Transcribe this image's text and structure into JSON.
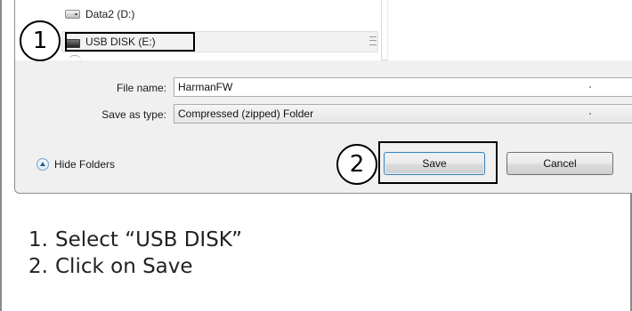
{
  "folder_tree": {
    "items": [
      {
        "label": "Data2 (D:)",
        "icon": "hard-drive-icon"
      },
      {
        "label": "USB DISK (E:)",
        "icon": "usb-drive-icon",
        "selected": true
      }
    ]
  },
  "form": {
    "file_name_label": "File name:",
    "file_name_value": "HarmanFW",
    "save_type_label": "Save as type:",
    "save_type_value": "Compressed (zipped) Folder"
  },
  "footer": {
    "hide_folders_label": "Hide Folders",
    "save_label": "Save",
    "cancel_label": "Cancel"
  },
  "callouts": {
    "step1_number": "1",
    "step2_number": "2"
  },
  "instructions": [
    {
      "number": "1.",
      "text": "Select “USB DISK”"
    },
    {
      "number": "2.",
      "text": "Click on Save"
    }
  ]
}
